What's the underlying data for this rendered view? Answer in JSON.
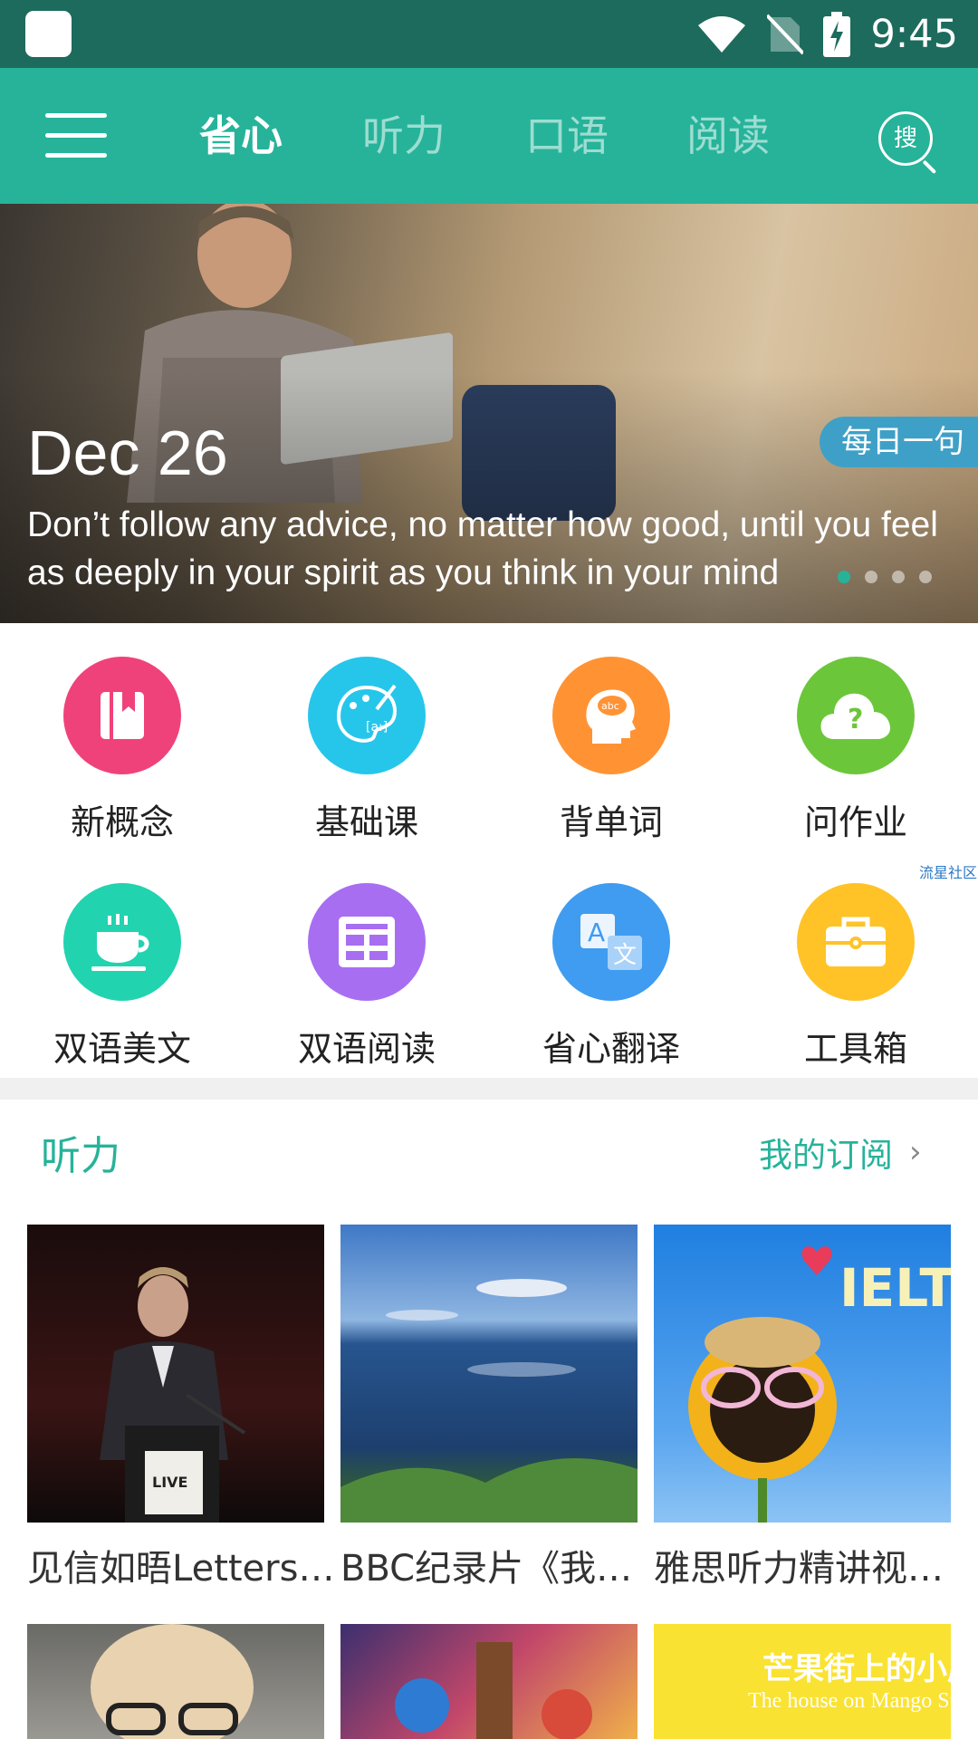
{
  "status_bar": {
    "time": "9:45"
  },
  "nav": {
    "tabs": [
      {
        "label": "省心",
        "active": true
      },
      {
        "label": "听力",
        "active": false
      },
      {
        "label": "口语",
        "active": false
      },
      {
        "label": "阅读",
        "active": false
      }
    ],
    "search_label": "搜"
  },
  "banner": {
    "date": "Dec 26",
    "quote": "Don’t follow any advice, no matter how good, until you feel as deeply in your spirit as you think in your mind",
    "badge": "每日一句",
    "slide_count": 4,
    "active_slide": 1
  },
  "grid": {
    "items": [
      {
        "label": "新概念",
        "icon": "book-icon",
        "color": "#f0427a"
      },
      {
        "label": "基础课",
        "icon": "palette-icon",
        "color": "#26c6ea"
      },
      {
        "label": "背单词",
        "icon": "head-icon",
        "color": "#ff9334"
      },
      {
        "label": "问作业",
        "icon": "cloud-question-icon",
        "color": "#6cc63a"
      },
      {
        "label": "双语美文",
        "icon": "cup-icon",
        "color": "#22d3b0"
      },
      {
        "label": "双语阅读",
        "icon": "newspaper-icon",
        "color": "#a86ef2"
      },
      {
        "label": "省心翻译",
        "icon": "translate-icon",
        "color": "#3f9cf0"
      },
      {
        "label": "工具箱",
        "icon": "toolbox-icon",
        "color": "#ffc328"
      }
    ],
    "watermark": "流星社区"
  },
  "section": {
    "title": "听力",
    "link": "我的订阅",
    "cards": [
      {
        "title": "见信如晤Letters…"
      },
      {
        "title": "BBC纪录片《我…"
      },
      {
        "title": "雅思听力精讲视…"
      }
    ],
    "card3_logo_text": "IELT",
    "card6_text": "芒果街上的小屋"
  },
  "colors": {
    "primary": "#26b39a",
    "status_bar": "#1d6b5d"
  }
}
